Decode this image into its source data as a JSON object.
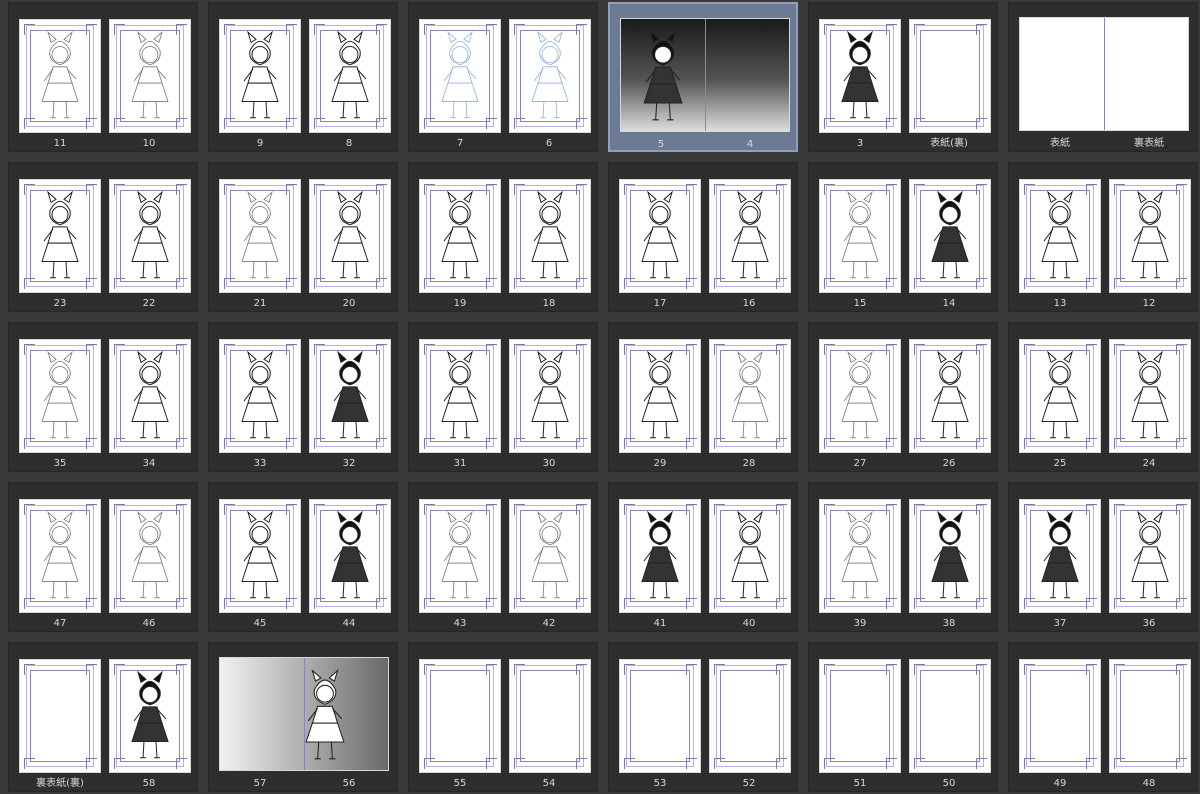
{
  "app": {
    "view": "page-manager-thumbnails"
  },
  "colors": {
    "background": "#3a3a3a",
    "tile": "#2e2e2e",
    "selected_tile": "#6c7a94",
    "guide": "#8a86b8",
    "label": "#d8d8d8"
  },
  "spreads": [
    {
      "row": 0,
      "col": 0,
      "type": "pair",
      "pages": [
        {
          "label": "11",
          "art": "sketch"
        },
        {
          "label": "10",
          "art": "sketch"
        }
      ]
    },
    {
      "row": 0,
      "col": 1,
      "type": "pair",
      "pages": [
        {
          "label": "9",
          "art": "ink"
        },
        {
          "label": "8",
          "art": "ink"
        }
      ]
    },
    {
      "row": 0,
      "col": 2,
      "type": "pair",
      "pages": [
        {
          "label": "7",
          "art": "bluesketch"
        },
        {
          "label": "6",
          "art": "bluesketch"
        }
      ]
    },
    {
      "row": 0,
      "col": 3,
      "type": "wide",
      "selected": true,
      "pages": [
        {
          "label": "5",
          "art": "wide-dark"
        },
        {
          "label": "4",
          "art": "wide-dark"
        }
      ]
    },
    {
      "row": 0,
      "col": 4,
      "type": "pair",
      "pages": [
        {
          "label": "3",
          "art": "ink-dark"
        },
        {
          "label": "表紙(裏)",
          "art": "blank"
        }
      ]
    },
    {
      "row": 0,
      "col": 5,
      "type": "wide",
      "pages": [
        {
          "label": "表紙",
          "art": "blank"
        },
        {
          "label": "裏表紙",
          "art": "blank"
        }
      ]
    },
    {
      "row": 1,
      "col": 0,
      "type": "pair",
      "pages": [
        {
          "label": "23",
          "art": "ink"
        },
        {
          "label": "22",
          "art": "ink"
        }
      ]
    },
    {
      "row": 1,
      "col": 1,
      "type": "pair",
      "pages": [
        {
          "label": "21",
          "art": "sketch"
        },
        {
          "label": "20",
          "art": "ink"
        }
      ]
    },
    {
      "row": 1,
      "col": 2,
      "type": "pair",
      "pages": [
        {
          "label": "19",
          "art": "ink"
        },
        {
          "label": "18",
          "art": "ink"
        }
      ]
    },
    {
      "row": 1,
      "col": 3,
      "type": "pair",
      "pages": [
        {
          "label": "17",
          "art": "ink"
        },
        {
          "label": "16",
          "art": "ink"
        }
      ]
    },
    {
      "row": 1,
      "col": 4,
      "type": "pair",
      "pages": [
        {
          "label": "15",
          "art": "sketch"
        },
        {
          "label": "14",
          "art": "ink-dark"
        }
      ]
    },
    {
      "row": 1,
      "col": 5,
      "type": "pair",
      "pages": [
        {
          "label": "13",
          "art": "ink"
        },
        {
          "label": "12",
          "art": "ink"
        }
      ]
    },
    {
      "row": 2,
      "col": 0,
      "type": "pair",
      "pages": [
        {
          "label": "35",
          "art": "sketch"
        },
        {
          "label": "34",
          "art": "ink"
        }
      ]
    },
    {
      "row": 2,
      "col": 1,
      "type": "pair",
      "pages": [
        {
          "label": "33",
          "art": "ink"
        },
        {
          "label": "32",
          "art": "ink-dark"
        }
      ]
    },
    {
      "row": 2,
      "col": 2,
      "type": "pair",
      "pages": [
        {
          "label": "31",
          "art": "ink"
        },
        {
          "label": "30",
          "art": "ink"
        }
      ]
    },
    {
      "row": 2,
      "col": 3,
      "type": "pair",
      "pages": [
        {
          "label": "29",
          "art": "ink"
        },
        {
          "label": "28",
          "art": "sketch"
        }
      ]
    },
    {
      "row": 2,
      "col": 4,
      "type": "pair",
      "pages": [
        {
          "label": "27",
          "art": "sketch"
        },
        {
          "label": "26",
          "art": "ink"
        }
      ]
    },
    {
      "row": 2,
      "col": 5,
      "type": "pair",
      "pages": [
        {
          "label": "25",
          "art": "ink"
        },
        {
          "label": "24",
          "art": "ink"
        }
      ]
    },
    {
      "row": 3,
      "col": 0,
      "type": "pair",
      "pages": [
        {
          "label": "47",
          "art": "sketch"
        },
        {
          "label": "46",
          "art": "sketch"
        }
      ]
    },
    {
      "row": 3,
      "col": 1,
      "type": "pair",
      "pages": [
        {
          "label": "45",
          "art": "ink"
        },
        {
          "label": "44",
          "art": "ink-dark"
        }
      ]
    },
    {
      "row": 3,
      "col": 2,
      "type": "pair",
      "pages": [
        {
          "label": "43",
          "art": "sketch"
        },
        {
          "label": "42",
          "art": "sketch"
        }
      ]
    },
    {
      "row": 3,
      "col": 3,
      "type": "pair",
      "pages": [
        {
          "label": "41",
          "art": "ink-dark"
        },
        {
          "label": "40",
          "art": "ink"
        }
      ]
    },
    {
      "row": 3,
      "col": 4,
      "type": "pair",
      "pages": [
        {
          "label": "39",
          "art": "sketch"
        },
        {
          "label": "38",
          "art": "ink-dark"
        }
      ]
    },
    {
      "row": 3,
      "col": 5,
      "type": "pair",
      "pages": [
        {
          "label": "37",
          "art": "ink-dark"
        },
        {
          "label": "36",
          "art": "ink"
        }
      ]
    },
    {
      "row": 4,
      "col": 0,
      "type": "pair",
      "pages": [
        {
          "label": "裏表紙(裏)",
          "art": "blank"
        },
        {
          "label": "58",
          "art": "ink-dark"
        }
      ]
    },
    {
      "row": 4,
      "col": 1,
      "type": "wide",
      "pages": [
        {
          "label": "57",
          "art": "wide-gray"
        },
        {
          "label": "56",
          "art": "wide-gray"
        }
      ]
    },
    {
      "row": 4,
      "col": 2,
      "type": "pair",
      "pages": [
        {
          "label": "55",
          "art": "blank"
        },
        {
          "label": "54",
          "art": "blank"
        }
      ]
    },
    {
      "row": 4,
      "col": 3,
      "type": "pair",
      "pages": [
        {
          "label": "53",
          "art": "blank"
        },
        {
          "label": "52",
          "art": "blank"
        }
      ]
    },
    {
      "row": 4,
      "col": 4,
      "type": "pair",
      "pages": [
        {
          "label": "51",
          "art": "blank"
        },
        {
          "label": "50",
          "art": "blank"
        }
      ]
    },
    {
      "row": 4,
      "col": 5,
      "type": "pair",
      "pages": [
        {
          "label": "49",
          "art": "blank"
        },
        {
          "label": "48",
          "art": "blank"
        }
      ]
    }
  ]
}
